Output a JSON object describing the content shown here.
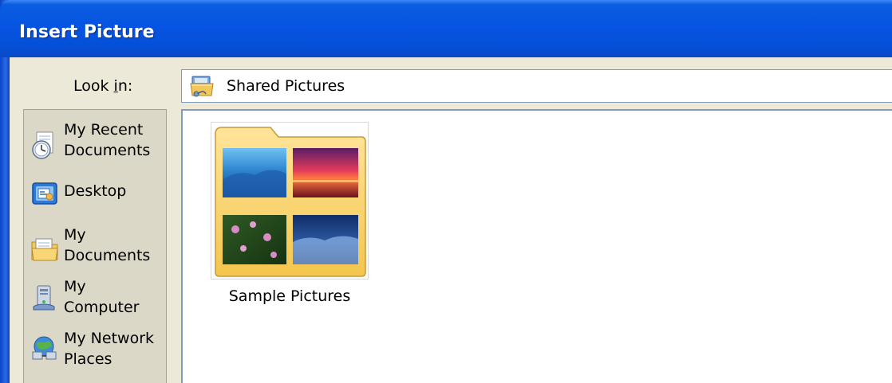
{
  "window": {
    "title": "Insert Picture"
  },
  "lookin": {
    "label_prefix": "Look ",
    "label_accel": "i",
    "label_suffix": "n:",
    "current_folder": "Shared Pictures",
    "folder_icon": "shared-folder-icon"
  },
  "places": [
    {
      "label": "My Recent\nDocuments",
      "icon": "recent-documents-icon"
    },
    {
      "label": "Desktop",
      "icon": "desktop-icon"
    },
    {
      "label": "My\nDocuments",
      "icon": "my-documents-icon"
    },
    {
      "label": "My\nComputer",
      "icon": "my-computer-icon"
    },
    {
      "label": "My Network\nPlaces",
      "icon": "network-places-icon"
    }
  ],
  "files": [
    {
      "name": "Sample Pictures",
      "icon": "picture-folder-icon"
    }
  ],
  "colors": {
    "titlebar": "#0654e2",
    "dialog_bg": "#ece9d8",
    "places_bg": "#dcd8c8",
    "input_border": "#7f9db9"
  }
}
